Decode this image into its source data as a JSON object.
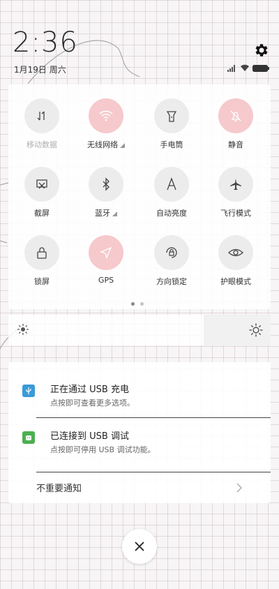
{
  "status": {
    "time": "2:36",
    "date": "1月19日 周六"
  },
  "quick_settings": {
    "tiles": [
      {
        "label": "移动数据",
        "icon": "mobile-data-icon",
        "active": false,
        "disabled": true
      },
      {
        "label": "无线网络",
        "icon": "wifi-icon",
        "active": true
      },
      {
        "label": "手电筒",
        "icon": "flashlight-icon",
        "active": false
      },
      {
        "label": "静音",
        "icon": "mute-icon",
        "active": true
      },
      {
        "label": "截屏",
        "icon": "screenshot-icon",
        "active": false
      },
      {
        "label": "蓝牙",
        "icon": "bluetooth-icon",
        "active": false
      },
      {
        "label": "自动亮度",
        "icon": "auto-brightness-icon",
        "active": false
      },
      {
        "label": "飞行模式",
        "icon": "airplane-icon",
        "active": false
      },
      {
        "label": "锁屏",
        "icon": "lock-icon",
        "active": false
      },
      {
        "label": "GPS",
        "icon": "gps-icon",
        "active": true
      },
      {
        "label": "方向锁定",
        "icon": "rotation-lock-icon",
        "active": false
      },
      {
        "label": "护眼模式",
        "icon": "eye-icon",
        "active": false
      }
    ],
    "page_count": 2,
    "current_page": 1
  },
  "notifications": [
    {
      "title": "正在通过 USB 充电",
      "subtitle": "点按即可查看更多选项。",
      "icon": "usb-icon",
      "icon_color": "#3a9ad9"
    },
    {
      "title": "已连接到 USB 调试",
      "subtitle": "点按即可停用 USB 调试功能。",
      "icon": "android-icon",
      "icon_color": "#4caf50"
    }
  ],
  "unimportant_label": "不重要通知",
  "colors": {
    "active_tile": "#f6c9cc",
    "inactive_tile": "#ececec"
  }
}
